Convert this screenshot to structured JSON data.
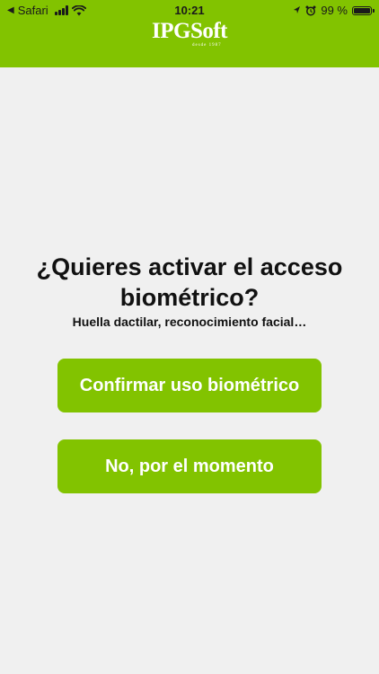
{
  "status_bar": {
    "back_app": "Safari",
    "time": "10:21",
    "battery_text": "99 %",
    "battery_level": 0.99
  },
  "header": {
    "logo_text": "IPGSoft",
    "logo_tagline": "desde 1987",
    "background_color": "#82c300"
  },
  "prompt": {
    "question": "¿Quieres activar el acceso biométrico?",
    "subtitle": "Huella dactilar, reconocimiento facial…"
  },
  "buttons": {
    "confirm_label": "Confirmar uso biométrico",
    "later_label": "No, por el momento",
    "color": "#82c300"
  },
  "icons": [
    "back-arrow-icon",
    "signal-icon",
    "wifi-icon",
    "location-icon",
    "alarm-icon",
    "battery-icon"
  ]
}
